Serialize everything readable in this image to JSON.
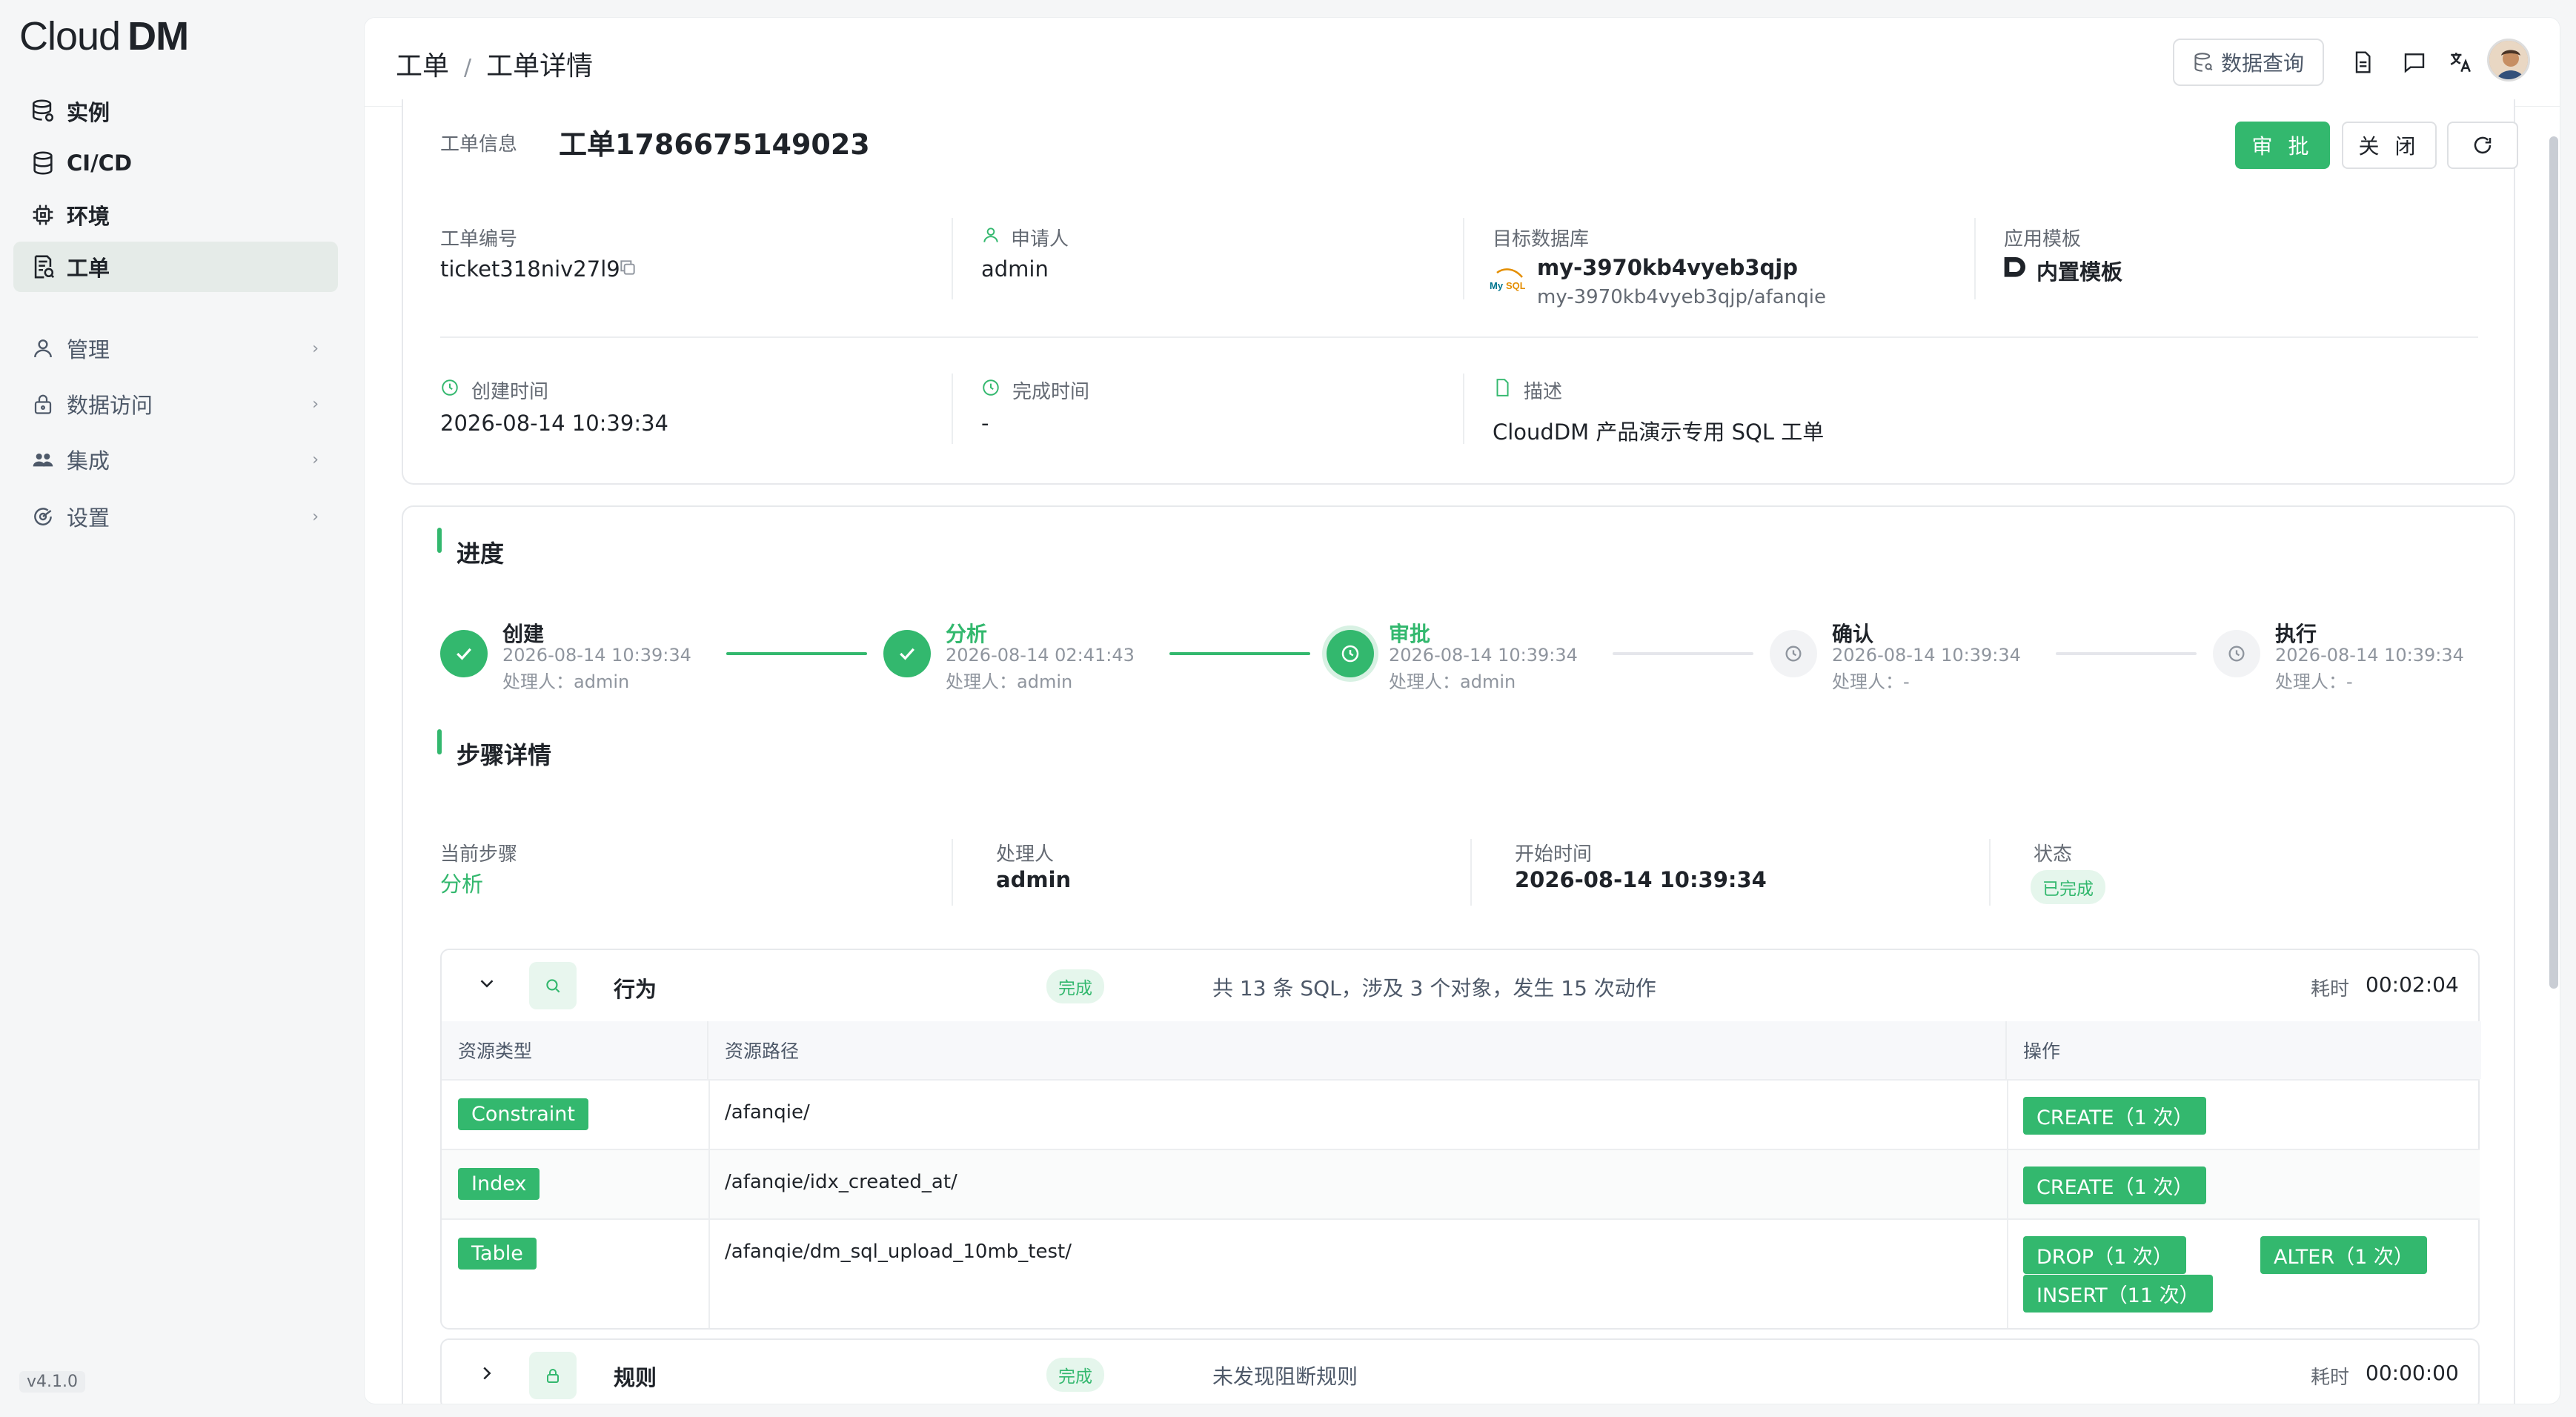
{
  "app": {
    "logo_part1": "Cloud",
    "logo_part2": "DM",
    "version": "v4.1.0"
  },
  "sidebar": {
    "items": [
      {
        "label": "实例",
        "icon": "database-stack-icon"
      },
      {
        "label": "CI/CD",
        "icon": "database-icon"
      },
      {
        "label": "环境",
        "icon": "chip-icon"
      },
      {
        "label": "工单",
        "icon": "ticket-icon"
      },
      {
        "label": "管理",
        "icon": "user-icon"
      },
      {
        "label": "数据访问",
        "icon": "lock-icon"
      },
      {
        "label": "集成",
        "icon": "users-icon"
      },
      {
        "label": "设置",
        "icon": "settings-icon"
      }
    ]
  },
  "header": {
    "breadcrumb_root": "工单",
    "breadcrumb_sep": "/",
    "breadcrumb_current": "工单详情",
    "data_query_label": "数据查询"
  },
  "ticket": {
    "section_label": "工单信息",
    "title": "工单1786675149023",
    "approve_label": "审 批",
    "close_label": "关 闭",
    "number_label": "工单编号",
    "number": "ticket318niv27l9",
    "applicant_label": "申请人",
    "applicant": "admin",
    "target_db_label": "目标数据库",
    "target_db": "my-3970kb4vyeb3qjp",
    "target_db_path": "my-3970kb4vyeb3qjp/afanqie",
    "mysql_logo_text": "My SQL",
    "template_label": "应用模板",
    "template": "内置模板",
    "created_label": "创建时间",
    "created": "2026-08-14 10:39:34",
    "finished_label": "完成时间",
    "finished": "-",
    "desc_label": "描述",
    "desc": "CloudDM 产品演示专用 SQL 工单"
  },
  "progress": {
    "title": "进度",
    "steps": [
      {
        "name": "创建",
        "time": "2026-08-14 10:39:34",
        "handler": "处理人：admin"
      },
      {
        "name": "分析",
        "time": "2026-08-14 02:41:43",
        "handler": "处理人：admin"
      },
      {
        "name": "审批",
        "time": "2026-08-14 10:39:34",
        "handler": "处理人：admin"
      },
      {
        "name": "确认",
        "time": "2026-08-14 10:39:34",
        "handler": "处理人：-"
      },
      {
        "name": "执行",
        "time": "2026-08-14 10:39:34",
        "handler": "处理人：-"
      }
    ]
  },
  "step_detail": {
    "title": "步骤详情",
    "current_step_label": "当前步骤",
    "current_step": "分析",
    "handler_label": "处理人",
    "handler": "admin",
    "start_label": "开始时间",
    "start": "2026-08-14 10:39:34",
    "status_label": "状态",
    "status": "已完成"
  },
  "behavior": {
    "name": "行为",
    "status": "完成",
    "summary": "共 13 条 SQL，涉及 3 个对象，发生 15 次动作",
    "elapsed_label": "耗时",
    "elapsed": "00:02:04",
    "columns": [
      "资源类型",
      "资源路径",
      "操作"
    ],
    "rows": [
      {
        "type": "Constraint",
        "path": "/afanqie/",
        "ops": [
          "CREATE（1 次）"
        ]
      },
      {
        "type": "Index",
        "path": "/afanqie/idx_created_at/",
        "ops": [
          "CREATE（1 次）"
        ]
      },
      {
        "type": "Table",
        "path": "/afanqie/dm_sql_upload_10mb_test/",
        "ops": [
          "DROP（1 次）",
          "ALTER（1 次）",
          "INSERT（11 次）"
        ]
      }
    ]
  },
  "rules": {
    "name": "规则",
    "status": "完成",
    "summary": "未发现阻断规则",
    "elapsed_label": "耗时",
    "elapsed": "00:00:00"
  },
  "colors": {
    "accent": "#33b86e",
    "accent_light": "#e5f6ec",
    "text": "#1f2329",
    "muted": "#8f959e"
  }
}
